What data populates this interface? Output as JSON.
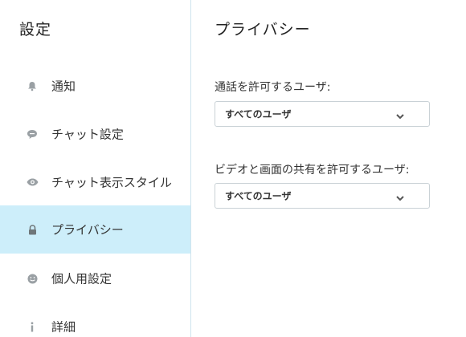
{
  "sidebar": {
    "title": "設定",
    "items": [
      {
        "label": "通知",
        "icon": "bell-icon"
      },
      {
        "label": "チャット設定",
        "icon": "chat-bubble-icon"
      },
      {
        "label": "チャット表示スタイル",
        "icon": "eye-icon"
      },
      {
        "label": "プライバシー",
        "icon": "lock-icon",
        "active": true
      },
      {
        "label": "個人用設定",
        "icon": "smiley-icon"
      },
      {
        "label": "詳細",
        "icon": "info-icon"
      }
    ]
  },
  "main": {
    "title": "プライバシー",
    "fields": [
      {
        "label": "通話を許可するユーザ:",
        "value": "すべてのユーザ"
      },
      {
        "label": "ビデオと画面の共有を許可するユーザ:",
        "value": "すべてのユーザ"
      }
    ]
  },
  "colors": {
    "active_bg": "#cdeefa",
    "icon": "#9aa0a4",
    "divider": "#cfe4ee"
  }
}
